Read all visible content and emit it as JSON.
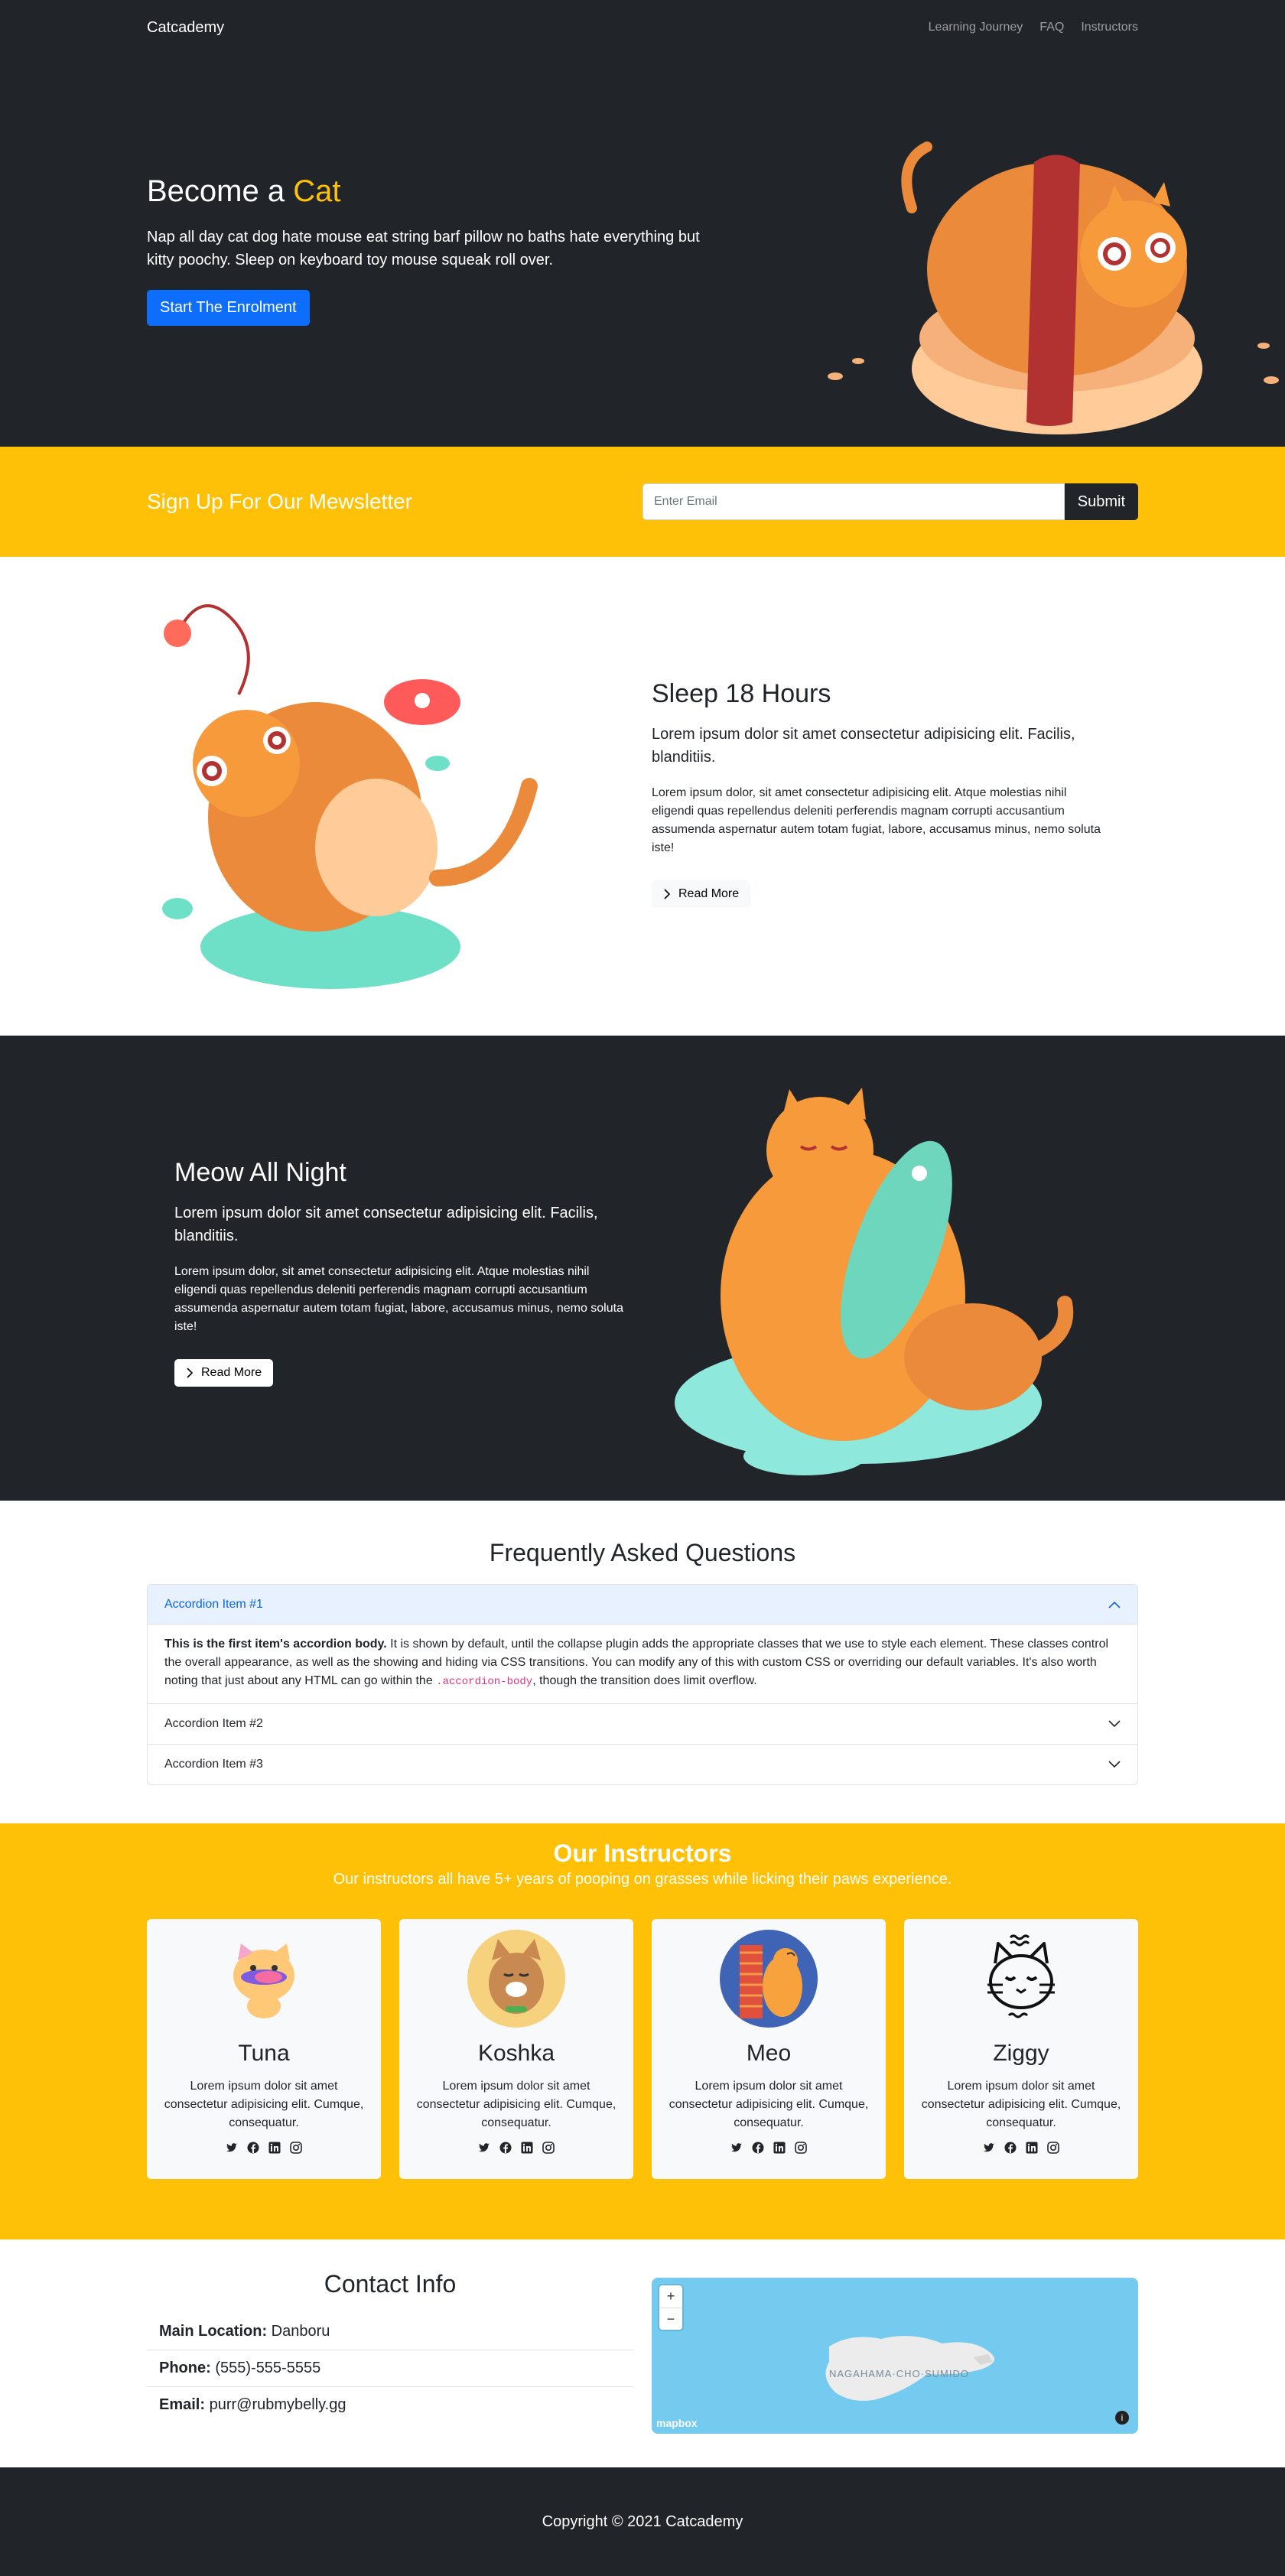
{
  "nav": {
    "brand": "Catcademy",
    "links": [
      "Learning Journey",
      "FAQ",
      "Instructors"
    ]
  },
  "hero": {
    "title_prefix": "Become a",
    "title_accent": "Cat",
    "lead": "Nap all day cat dog hate mouse eat string barf pillow no baths hate everything but kitty poochy. Sleep on keyboard toy mouse squeak roll over.",
    "cta": "Start The Enrolment",
    "accent_color": "#ffc107"
  },
  "newsletter": {
    "title": "Sign Up For Our Mewsletter",
    "placeholder": "Enter Email",
    "submit": "Submit"
  },
  "feature1": {
    "title": "Sleep 18 Hours",
    "lead": "Lorem ipsum dolor sit amet consectetur adipisicing elit. Facilis, blanditiis.",
    "body": "Lorem ipsum dolor, sit amet consectetur adipisicing elit. Atque molestias nihil eligendi quas repellendus deleniti perferendis magnam corrupti accusantium assumenda aspernatur autem totam fugiat, labore, accusamus minus, nemo soluta iste!",
    "button": "Read More"
  },
  "feature2": {
    "title": "Meow All Night",
    "lead": "Lorem ipsum dolor sit amet consectetur adipisicing elit. Facilis, blanditiis.",
    "body": "Lorem ipsum dolor, sit amet consectetur adipisicing elit. Atque molestias nihil eligendi quas repellendus deleniti perferendis magnam corrupti accusantium assumenda aspernatur autem totam fugiat, labore, accusamus minus, nemo soluta iste!",
    "button": "Read More"
  },
  "faq": {
    "title": "Frequently Asked Questions",
    "items": [
      {
        "label": "Accordion Item #1",
        "body_strong": "This is the first item's accordion body.",
        "body_text": " It is shown by default, until the collapse plugin adds the appropriate classes that we use to style each element. These classes control the overall appearance, as well as the showing and hiding via CSS transitions. You can modify any of this with custom CSS or overriding our default variables. It's also worth noting that just about any HTML can go within the ",
        "body_code": ".accordion-body",
        "body_tail": ", though the transition does limit overflow."
      },
      {
        "label": "Accordion Item #2"
      },
      {
        "label": "Accordion Item #3"
      }
    ]
  },
  "instructors": {
    "title": "Our Instructors",
    "subtitle": "Our instructors all have 5+ years of pooping on grasses while licking their paws experience.",
    "cards": [
      {
        "name": "Tuna",
        "text": "Lorem ipsum dolor sit amet consectetur adipisicing elit. Cumque, consequatur."
      },
      {
        "name": "Koshka",
        "text": "Lorem ipsum dolor sit amet consectetur adipisicing elit. Cumque, consequatur."
      },
      {
        "name": "Meo",
        "text": "Lorem ipsum dolor sit amet consectetur adipisicing elit. Cumque, consequatur."
      },
      {
        "name": "Ziggy",
        "text": "Lorem ipsum dolor sit amet consectetur adipisicing elit. Cumque, consequatur."
      }
    ],
    "social_icons": [
      "twitter-icon",
      "facebook-icon",
      "linkedin-icon",
      "instagram-icon"
    ]
  },
  "contact": {
    "title": "Contact Info",
    "location_label": "Main Location:",
    "location_value": " Danboru",
    "phone_label": "Phone:",
    "phone_value": " (555)-555-5555",
    "email_label": "Email:",
    "email_value": " purr@rubmybelly.gg"
  },
  "map": {
    "zoom_in": "+",
    "zoom_out": "−",
    "logo": "mapbox",
    "info": "i",
    "place_label": "NAGAHAMA·CHO·SUMIDO"
  },
  "footer": {
    "copyright": "Copyright © 2021 Catcademy"
  }
}
